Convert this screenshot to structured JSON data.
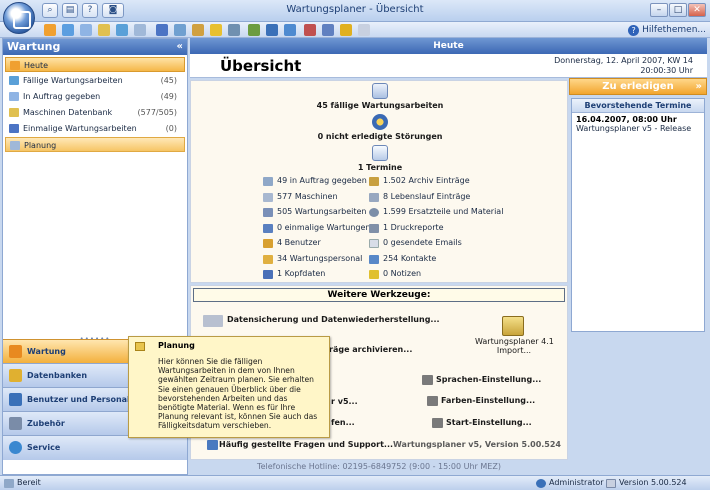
{
  "window": {
    "title": "Wartungsplaner - Übersicht",
    "help_topics": "Hilfethemen..."
  },
  "sidebar": {
    "title": "Wartung",
    "collapse": "«",
    "items": [
      {
        "label": "Heute",
        "count": ""
      },
      {
        "label": "Fällige Wartungsarbeiten",
        "count": "(45)"
      },
      {
        "label": "In Auftrag gegeben",
        "count": "(49)"
      },
      {
        "label": "Maschinen Datenbank",
        "count": "(577/505)"
      },
      {
        "label": "Einmalige Wartungsarbeiten",
        "count": "(0)"
      },
      {
        "label": "Planung",
        "count": ""
      }
    ],
    "groups": [
      "Wartung",
      "Datenbanken",
      "Benutzer und Personal",
      "Zubehör",
      "Service"
    ]
  },
  "main": {
    "header": "Heute",
    "title": "Übersicht",
    "date_line": "Donnerstag, 12. April 2007, KW 14",
    "time_line": "20:00:30 Uhr",
    "summary": {
      "due": "45 fällige Wartungsarbeiten",
      "faults": "0 nicht erledigte Störungen",
      "appointments": "1 Termine"
    },
    "stats_left": [
      "49 in Auftrag gegeben",
      "577 Maschinen",
      "505 Wartungsarbeiten",
      "0 einmalige Wartungen",
      "4 Benutzer",
      "34 Wartungspersonal",
      "1 Kopfdaten"
    ],
    "stats_right": [
      "1.502 Archiv Einträge",
      "8 Lebenslauf Einträge",
      "1.599 Ersatzteile und Material",
      "1 Druckreporte",
      "0 gesendete Emails",
      "254 Kontakte",
      "0 Notizen"
    ],
    "tools": {
      "title": "Weitere Werkzeuge:",
      "backup": "Datensicherung und Datenwiederherstellung...",
      "archive": "räge archivieren...",
      "import": "Wartungsplaner 4.1",
      "import2": "Import...",
      "v5": "r v5...",
      "language": "Sprachen-Einstellung...",
      "colors": "Farben-Einstellung...",
      "start": "Start-Einstellung...",
      "fen": "fen...",
      "faq": "Häufig gestellte Fragen und Support...",
      "version": "Wartungsplaner v5, Version 5.00.524"
    },
    "hotline": "Telefonische Hotline: 02195-6849752 (9:00 - 15:00 Uhr MEZ)"
  },
  "right": {
    "todo": "Zu erledigen",
    "todo_arrow": "»",
    "appointments_title": "Bevorstehende Termine",
    "appointment_date": "16.04.2007, 08:00 Uhr",
    "appointment_desc": "Wartungsplaner v5 - Release"
  },
  "tooltip": {
    "title": "Planung",
    "body": "Hier können Sie die fälligen Wartungsarbeiten in dem von Ihnen gewählten Zeitraum planen. Sie erhalten Sie einen genauen Überblick über die bevorstehenden Arbeiten und das benötigte Material. Wenn es für Ihre Planung relevant ist, können Sie auch das Fälligkeitsdatum verschieben."
  },
  "status": {
    "ready": "Bereit",
    "user": "Administrator",
    "version": "Version 5.00.524"
  },
  "colors": {
    "accent_orange": "#f3b03d",
    "header_blue": "#3c68b4"
  }
}
